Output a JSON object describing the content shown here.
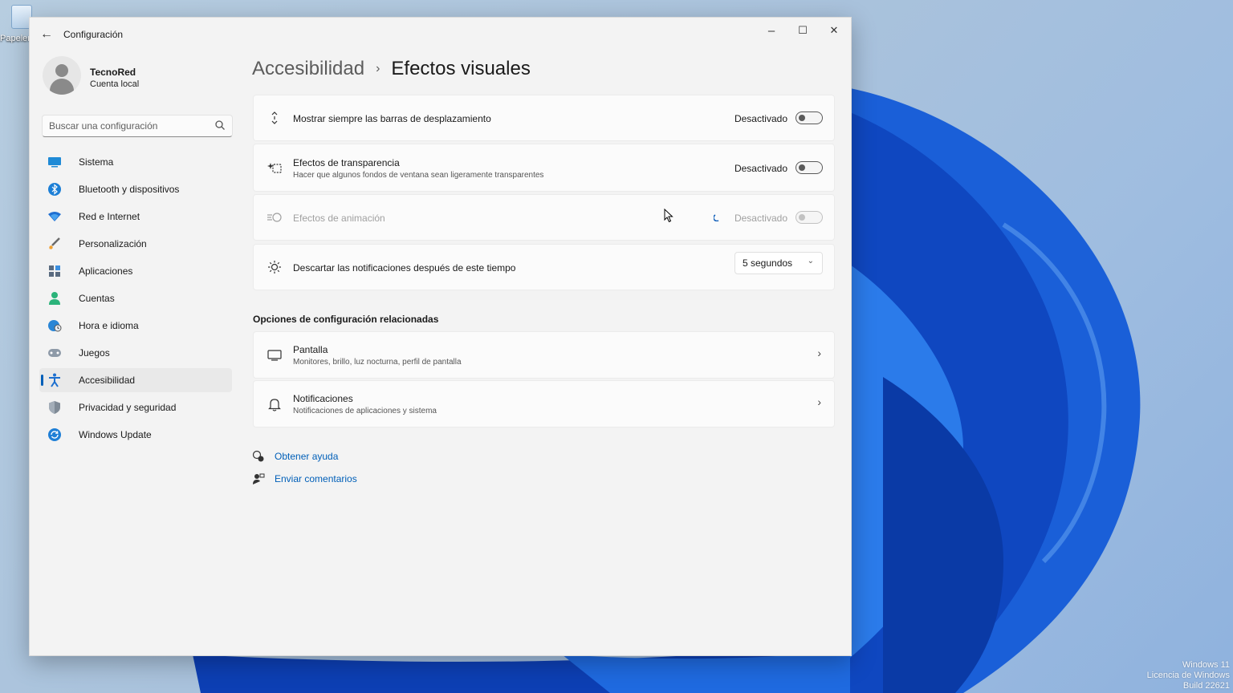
{
  "desktop": {
    "recycle_bin_label": "Papelera de recicl",
    "watermark_lines": [
      "Windows 11",
      "Licencia de Windows",
      "Build 22621"
    ]
  },
  "window": {
    "app_title": "Configuración",
    "controls": {
      "minimize": "–",
      "maximize": "☐",
      "close": "✕"
    }
  },
  "profile": {
    "name": "TecnoRed",
    "account_type": "Cuenta local"
  },
  "search": {
    "placeholder": "Buscar una configuración"
  },
  "sidebar": {
    "items": [
      {
        "label": "Sistema",
        "icon": "system-icon"
      },
      {
        "label": "Bluetooth y dispositivos",
        "icon": "bluetooth-icon"
      },
      {
        "label": "Red e Internet",
        "icon": "wifi-icon"
      },
      {
        "label": "Personalización",
        "icon": "brush-icon"
      },
      {
        "label": "Aplicaciones",
        "icon": "apps-icon"
      },
      {
        "label": "Cuentas",
        "icon": "accounts-icon"
      },
      {
        "label": "Hora e idioma",
        "icon": "globe-clock-icon"
      },
      {
        "label": "Juegos",
        "icon": "gamepad-icon"
      },
      {
        "label": "Accesibilidad",
        "icon": "accessibility-icon",
        "active": true
      },
      {
        "label": "Privacidad y seguridad",
        "icon": "shield-icon"
      },
      {
        "label": "Windows Update",
        "icon": "update-icon"
      }
    ]
  },
  "breadcrumb": {
    "parent": "Accesibilidad",
    "separator": "›",
    "current": "Efectos visuales"
  },
  "settings": {
    "scrollbars": {
      "title": "Mostrar siempre las barras de desplazamiento",
      "state": "Desactivado"
    },
    "transparency": {
      "title": "Efectos de transparencia",
      "subtitle": "Hacer que algunos fondos de ventana sean ligeramente transparentes",
      "state": "Desactivado"
    },
    "animation": {
      "title": "Efectos de animación",
      "state": "Desactivado"
    },
    "notifications": {
      "title": "Descartar las notificaciones después de este tiempo",
      "value": "5 segundos"
    }
  },
  "related": {
    "heading": "Opciones de configuración relacionadas",
    "display": {
      "title": "Pantalla",
      "subtitle": "Monitores, brillo, luz nocturna, perfil de pantalla"
    },
    "notifications": {
      "title": "Notificaciones",
      "subtitle": "Notificaciones de aplicaciones y sistema"
    }
  },
  "links": {
    "help": "Obtener ayuda",
    "feedback": "Enviar comentarios"
  },
  "colors": {
    "accent": "#005fb8",
    "window_bg": "#f3f3f3",
    "card_bg": "#fbfbfb"
  }
}
